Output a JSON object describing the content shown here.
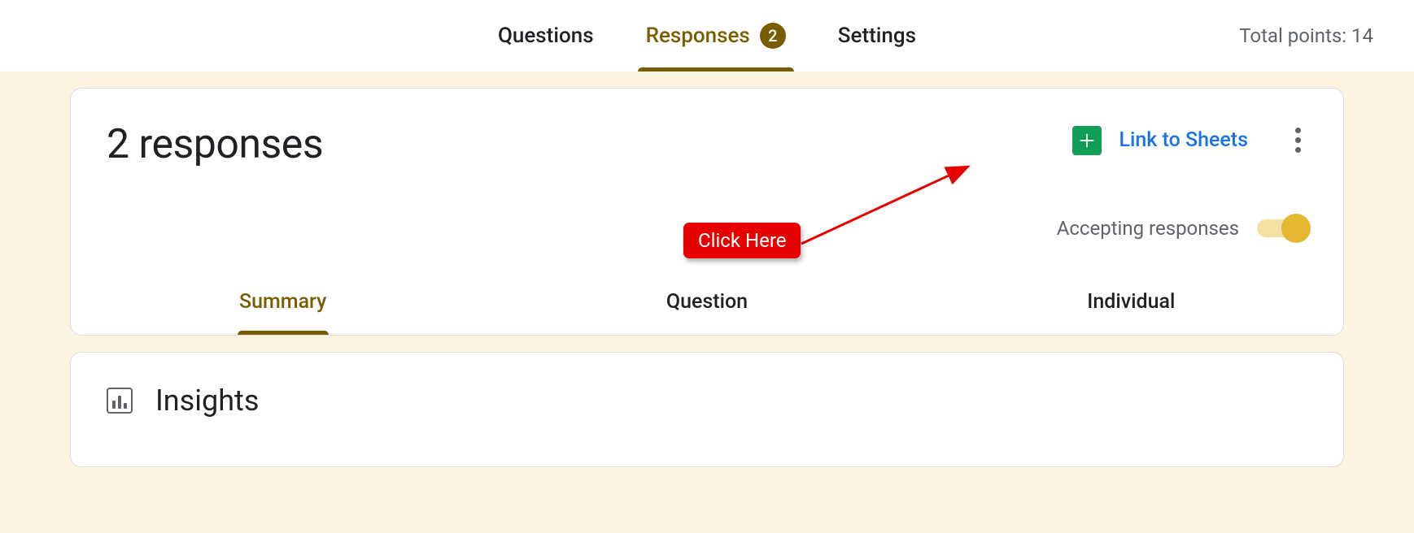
{
  "nav": {
    "tabs": [
      {
        "label": "Questions",
        "active": false
      },
      {
        "label": "Responses",
        "active": true,
        "badge": "2"
      },
      {
        "label": "Settings",
        "active": false
      }
    ],
    "total_points": "Total points: 14"
  },
  "responses": {
    "title": "2 responses",
    "link_to_sheets": "Link to Sheets",
    "accepting_label": "Accepting responses",
    "accepting_on": true,
    "subtabs": [
      {
        "label": "Summary",
        "active": true
      },
      {
        "label": "Question",
        "active": false
      },
      {
        "label": "Individual",
        "active": false
      }
    ]
  },
  "insights": {
    "title": "Insights"
  },
  "annotation": {
    "label": "Click Here"
  }
}
